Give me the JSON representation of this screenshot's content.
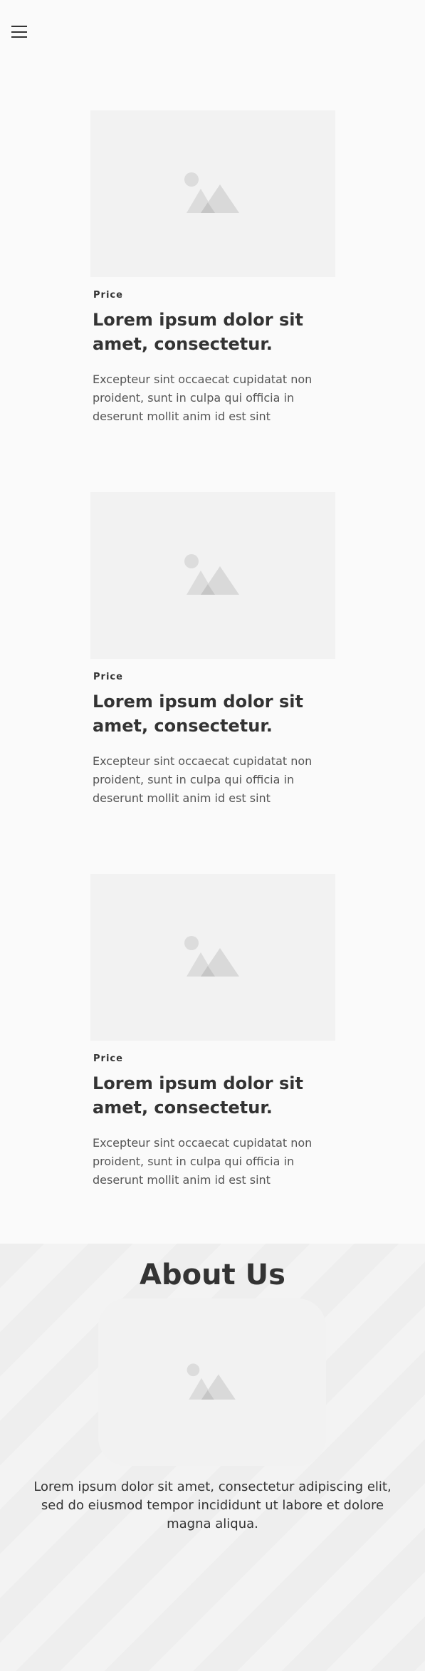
{
  "header": {
    "menu_icon": "hamburger-menu-icon"
  },
  "cards": [
    {
      "label": "Price",
      "title": "Lorem ipsum dolor sit amet, consectetur.",
      "text": "Excepteur sint occaecat cupidatat non proident, sunt in culpa qui officia in deserunt mollit anim id est sint",
      "image_icon": "image-placeholder-icon"
    },
    {
      "label": "Price",
      "title": "Lorem ipsum dolor sit amet, consectetur.",
      "text": "Excepteur sint occaecat cupidatat non proident, sunt in culpa qui officia in deserunt mollit anim id est sint",
      "image_icon": "image-placeholder-icon"
    },
    {
      "label": "Price",
      "title": "Lorem ipsum dolor sit amet, consectetur.",
      "text": "Excepteur sint occaecat cupidatat non proident, sunt in culpa qui officia in deserunt mollit anim id est sint",
      "image_icon": "image-placeholder-icon"
    }
  ],
  "about": {
    "title": "About Us",
    "text": "Lorem ipsum dolor sit amet, consectetur adipiscing elit, sed do eiusmod tempor incididunt ut labore et dolore magna aliqua.",
    "image_icon": "image-placeholder-icon"
  },
  "colors": {
    "background": "#fafafa",
    "text": "#333333",
    "muted_text": "#555555",
    "placeholder": "#f2f2f2"
  }
}
